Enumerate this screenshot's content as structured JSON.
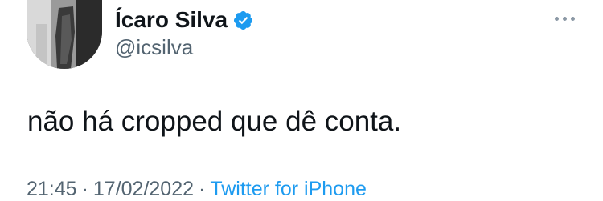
{
  "tweet": {
    "author": {
      "display_name": "Ícaro Silva",
      "handle": "@icsilva",
      "verified": true,
      "verified_color": "#1d9bf0"
    },
    "text": "não há cropped que dê conta.",
    "meta": {
      "time": "21:45",
      "separator": "·",
      "date": "17/02/2022",
      "source": "Twitter for iPhone"
    },
    "icons": {
      "avatar": "avatar-photo",
      "verified": "verified-badge-icon",
      "more": "more-options-icon"
    }
  }
}
